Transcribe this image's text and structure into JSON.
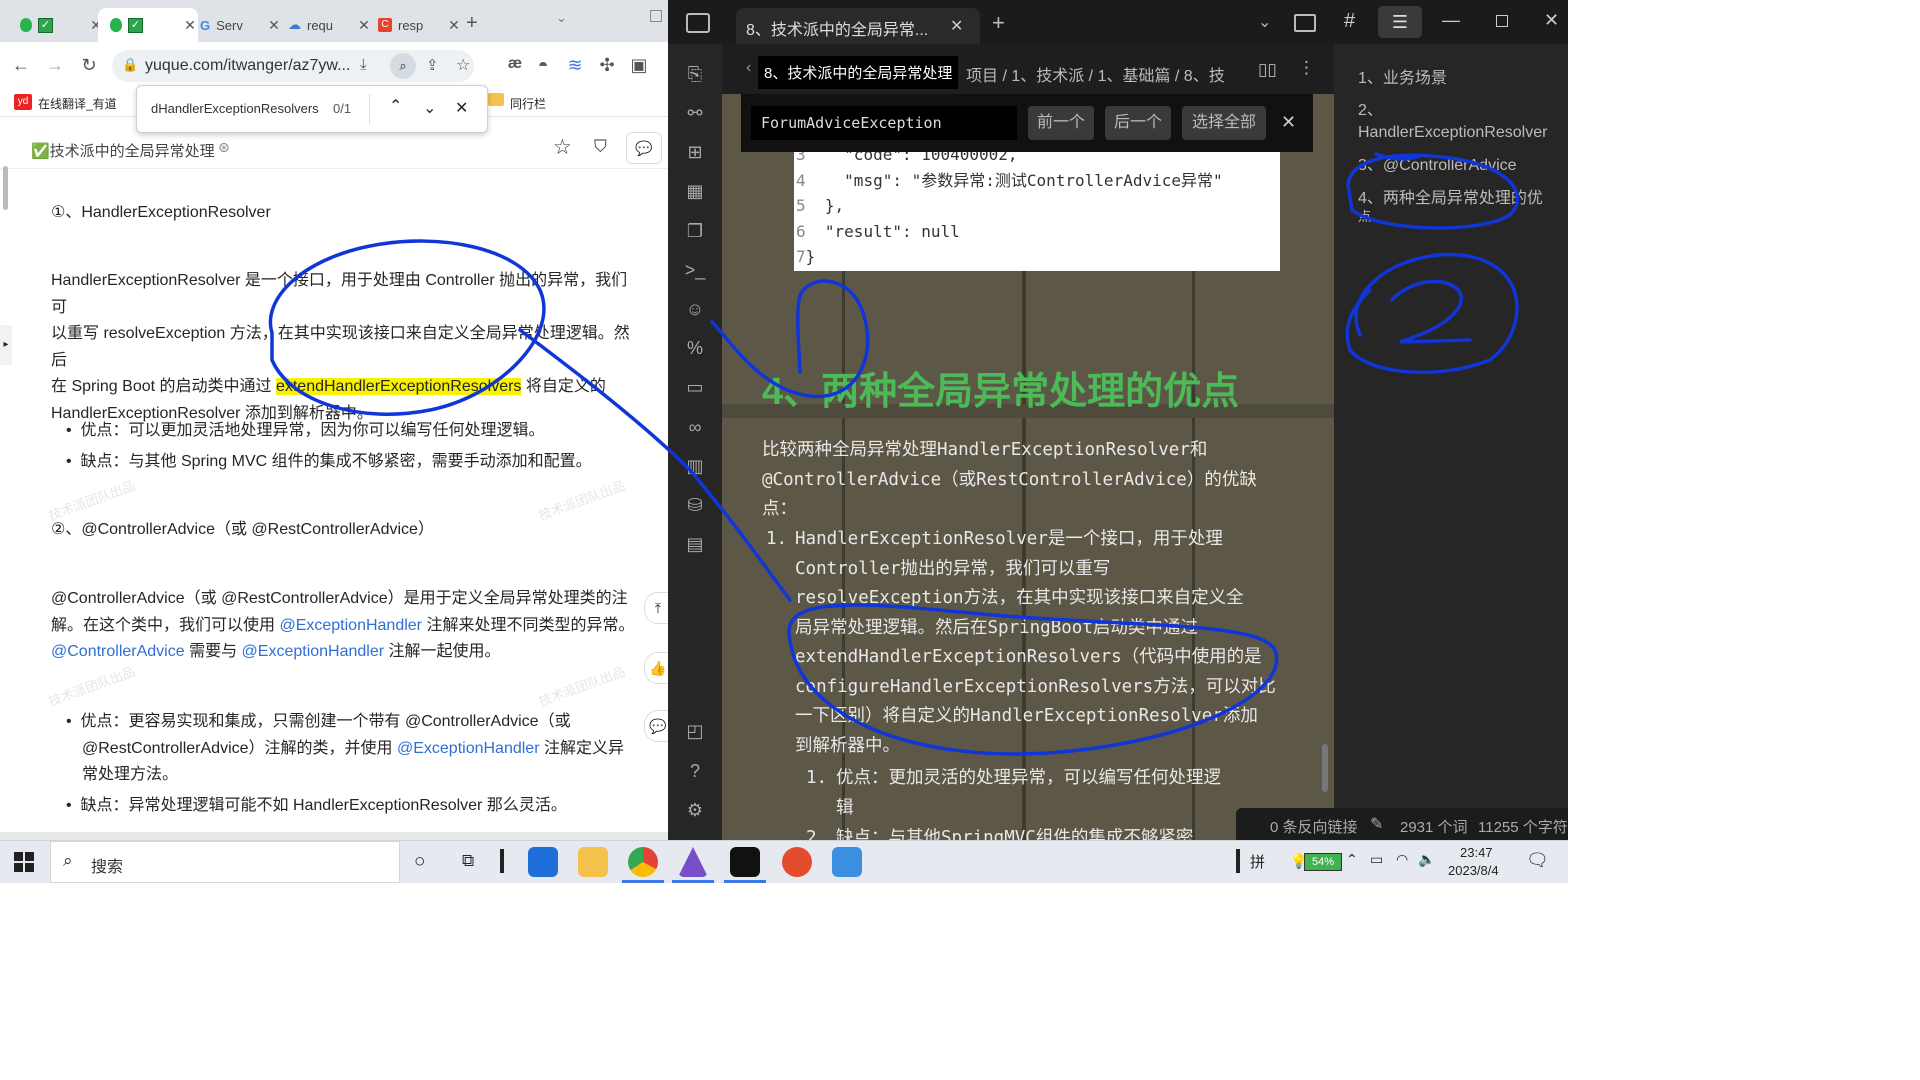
{
  "browser": {
    "tabs": [
      {
        "label": "",
        "active": false
      },
      {
        "label": "",
        "active": true
      },
      {
        "label": "Serv",
        "active": false
      },
      {
        "label": "requ",
        "active": false
      },
      {
        "label": "resp",
        "active": false
      }
    ],
    "new_tab": "+",
    "url": "yuque.com/itwanger/az7yw...",
    "bookmarks": {
      "youdao": "在线翻译_有道",
      "folder": "同行栏"
    },
    "find": {
      "query": "dHandlerExceptionResolvers",
      "count": "0/1"
    }
  },
  "doc": {
    "title": "✅技术派中的全局异常处理",
    "h1": "①、HandlerExceptionResolver",
    "p1a": "HandlerExceptionResolver 是一个接口，用于处理由 Controller 抛出的异常，我们可",
    "p1b": "以重写 resolveException 方法，在其中实现该接口来自定义全局异常处理逻辑。然后",
    "p1c_pre": "在 Spring Boot 的启动类中通过 ",
    "p1c_hl": "extendHandlerExceptionResolvers",
    "p1c_post": " 将自定义的",
    "p1d": "HandlerExceptionResolver 添加到解析器中。",
    "pro1": "优点：可以更加灵活地处理异常，因为你可以编写任何处理逻辑。",
    "con1": "缺点：与其他 Spring MVC 组件的集成不够紧密，需要手动添加和配置。",
    "h2": "②、@ControllerAdvice（或 @RestControllerAdvice）",
    "p2a": "@ControllerAdvice（或 @RestControllerAdvice）是用于定义全局异常处理类的注",
    "p2b_pre": "解。在这个类中，我们可以使用 ",
    "p2b_link": "@ExceptionHandler",
    "p2b_post": " 注解来处理不同类型的异常。",
    "p2c_link1": "@ControllerAdvice",
    "p2c_mid": " 需要与 ",
    "p2c_link2": "@ExceptionHandler",
    "p2c_post": " 注解一起使用。",
    "pro2a": "优点：更容易实现和集成，只需创建一个带有 @ControllerAdvice（或",
    "pro2b_pre": "@RestControllerAdvice）注解的类，并使用 ",
    "pro2b_link": "@ExceptionHandler",
    "pro2b_post": " 注解定义异",
    "pro2c": "常处理方法。",
    "con2": "缺点：异常处理逻辑可能不如 HandlerExceptionResolver 那么灵活。",
    "watermark": "技术派团队出品"
  },
  "obsidian": {
    "tab_title": "8、技术派中的全局异常...",
    "breadcrumb_title": "8、技术派中的全局异常处理",
    "breadcrumb": "项目 / 1、技术派 / 1、基础篇 / 8、技",
    "find_query": "ForumAdviceException",
    "btn_prev": "前一个",
    "btn_next": "后一个",
    "btn_all": "选择全部",
    "code_lines": [
      {
        "n": "3",
        "t": "    \"code\": 100400002,"
      },
      {
        "n": "4",
        "t": "    \"msg\": \"参数异常:测试ControllerAdvice异常\""
      },
      {
        "n": "5",
        "t": "  },"
      },
      {
        "n": "6",
        "t": "  \"result\": null"
      },
      {
        "n": "7",
        "t": "}"
      }
    ],
    "heading": "4、两种全局异常处理的优点",
    "para_lines": [
      "比较两种全局异常处理HandlerExceptionResolver和",
      "@ControllerAdvice（或RestControllerAdvice）的优缺",
      "点："
    ],
    "li1_num": "1.",
    "li1_lines": [
      "HandlerExceptionResolver是一个接口，用于处理",
      "Controller抛出的异常，我们可以重写",
      "resolveException方法，在其中实现该接口来自定义全",
      "局异常处理逻辑。然后在SpringBoot启动类中通过",
      "extendHandlerExceptionResolvers（代码中使用的是",
      "configureHandlerExceptionResolvers方法，可以对比",
      "一下区别）将自定义的HandlerExceptionResolver添加",
      "到解析器中。"
    ],
    "sub1_num": "1.",
    "sub1_lines": [
      "优点：更加灵活的处理异常，可以编写任何处理逻",
      "辑"
    ],
    "sub2_num": "2.",
    "sub2_text": "缺点：与其他SpringMVC组件的集成不够紧密",
    "outline": [
      "1、业务场景",
      "2、",
      "HandlerExceptionResolver",
      "3、@ControllerAdvice",
      "4、两种全局异常处理的优",
      "点"
    ],
    "status": {
      "backlinks": "0 条反向链接",
      "words": "2931 个词",
      "chars": "11255 个字符"
    }
  },
  "taskbar": {
    "search": "搜索",
    "battery": "54%",
    "ime": "拼",
    "time": "23:47",
    "date": "2023/8/4"
  },
  "annotations": {
    "one": "1",
    "two": "2"
  }
}
